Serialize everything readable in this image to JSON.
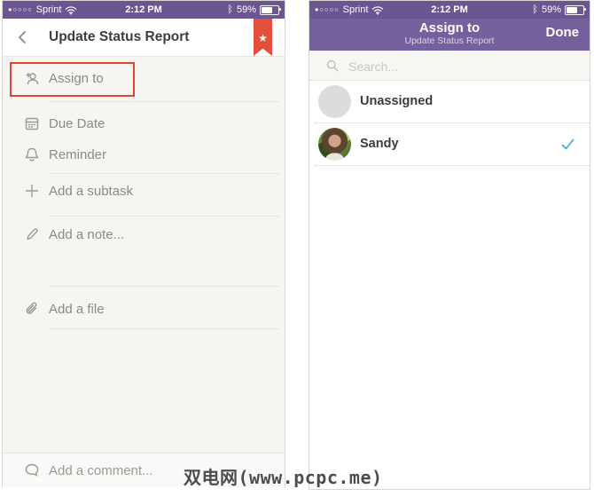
{
  "watermark_text": "双电网(www.pcpc.me)",
  "status_bar": {
    "signal_dots": "●○○○○",
    "carrier": "Sprint",
    "time": "2:12 PM",
    "battery_percent": "59%"
  },
  "left_phone": {
    "nav_title": "Update Status Report",
    "rows": {
      "assign": "Assign to",
      "due_date": "Due Date",
      "reminder": "Reminder",
      "subtask": "Add a subtask",
      "note": "Add a note...",
      "file": "Add a file",
      "comment": "Add a comment..."
    },
    "flag_icon": "★"
  },
  "right_phone": {
    "nav_title": "Assign to",
    "nav_subtitle": "Update Status Report",
    "done_label": "Done",
    "search_placeholder": "Search...",
    "list": [
      {
        "name": "Unassigned",
        "selected": false
      },
      {
        "name": "Sandy",
        "selected": true
      }
    ]
  },
  "colors": {
    "header_purple": "#75609e",
    "statusbar_purple": "#6b5692",
    "highlight_red": "#e0452f",
    "ribbon_red": "#e2503c",
    "check_blue": "#3fa8ea"
  }
}
